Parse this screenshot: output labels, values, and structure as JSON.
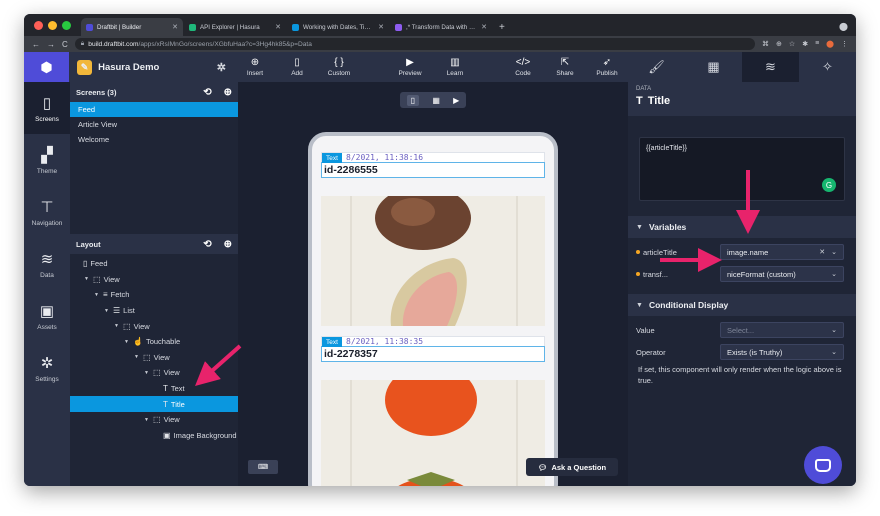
{
  "browser": {
    "tabs": [
      {
        "label": "Draftbit | Builder",
        "color": "#4f4cd8",
        "active": true
      },
      {
        "label": "API Explorer | Hasura",
        "color": "#1fb77a",
        "active": false
      },
      {
        "label": "Working with Dates, Time, Tim",
        "color": "#0a97df",
        "active": false
      },
      {
        "label": ",* Transform Data with Custom",
        "color": "#8e5cf0",
        "active": false
      }
    ],
    "url_host": "build.draftbit.com",
    "url_path": "/apps/xRsIMnGo/screens/XGbfuHaa?c=3Hg4hk85&p=Data"
  },
  "header": {
    "project_name": "Hasura Demo",
    "tools": [
      {
        "label": "Insert",
        "icon": "⊕"
      },
      {
        "label": "Add",
        "icon": "▯"
      },
      {
        "label": "Custom",
        "icon": "{ }"
      },
      {
        "label": "Preview",
        "icon": "▶"
      },
      {
        "label": "Learn",
        "icon": "▥"
      },
      {
        "label": "Code",
        "icon": "</>"
      },
      {
        "label": "Share",
        "icon": "⇱"
      },
      {
        "label": "Publish",
        "icon": "➶"
      }
    ]
  },
  "rail": [
    {
      "label": "Screens",
      "icon": "▯"
    },
    {
      "label": "Theme",
      "icon": "▞"
    },
    {
      "label": "Navigation",
      "icon": "⊤"
    },
    {
      "label": "Data",
      "icon": "≋"
    },
    {
      "label": "Assets",
      "icon": "▣"
    },
    {
      "label": "Settings",
      "icon": "✲"
    }
  ],
  "screens_panel": {
    "title": "Screens (3)",
    "items": [
      {
        "label": "Feed",
        "selected": true
      },
      {
        "label": "Article View",
        "selected": false
      },
      {
        "label": "Welcome",
        "selected": false
      }
    ]
  },
  "layout_panel": {
    "title": "Layout",
    "tree": [
      {
        "label": "Feed",
        "indent": 0,
        "icon": "▯",
        "caret": false,
        "selected": false
      },
      {
        "label": "View",
        "indent": 1,
        "icon": "⬚",
        "caret": true,
        "selected": false
      },
      {
        "label": "Fetch",
        "indent": 2,
        "icon": "≡",
        "caret": true,
        "selected": false
      },
      {
        "label": "List",
        "indent": 3,
        "icon": "☰",
        "caret": true,
        "selected": false
      },
      {
        "label": "View",
        "indent": 4,
        "icon": "⬚",
        "caret": true,
        "selected": false
      },
      {
        "label": "Touchable",
        "indent": 5,
        "icon": "☝",
        "caret": true,
        "selected": false
      },
      {
        "label": "View",
        "indent": 6,
        "icon": "⬚",
        "caret": true,
        "selected": false
      },
      {
        "label": "View",
        "indent": 7,
        "icon": "⬚",
        "caret": true,
        "selected": false
      },
      {
        "label": "Text",
        "indent": 8,
        "icon": "T",
        "caret": false,
        "selected": false
      },
      {
        "label": "Title",
        "indent": 8,
        "icon": "T",
        "caret": false,
        "selected": true
      },
      {
        "label": "View",
        "indent": 7,
        "icon": "⬚",
        "caret": true,
        "selected": false
      },
      {
        "label": "Image Background",
        "indent": 8,
        "icon": "▣",
        "caret": false,
        "selected": false
      }
    ]
  },
  "canvas": {
    "cards": [
      {
        "badge": "Text",
        "date": "8/2021, 11:38:16",
        "title": "id-2286555"
      },
      {
        "badge": "Text",
        "date": "8/2021, 11:38:35",
        "title": "id-2278357"
      }
    ],
    "ask_label": "Ask a Question"
  },
  "right_panel": {
    "section_label": "DATA",
    "component_title": "Title",
    "code_value": "{{articleTitle}}",
    "variables_title": "Variables",
    "variables": [
      {
        "name": "articleTitle",
        "value": "image.name"
      },
      {
        "name": "transf...",
        "value": "niceFormat (custom)"
      }
    ],
    "conditional_title": "Conditional Display",
    "value_label": "Value",
    "value_placeholder": "Select...",
    "operator_label": "Operator",
    "operator_value": "Exists (is Truthy)",
    "info_text": "If set, this component will only render when the logic above is true."
  },
  "colors": {
    "accent": "#4f4cd8",
    "selection": "#0a97df",
    "arrow": "#e8236b"
  }
}
